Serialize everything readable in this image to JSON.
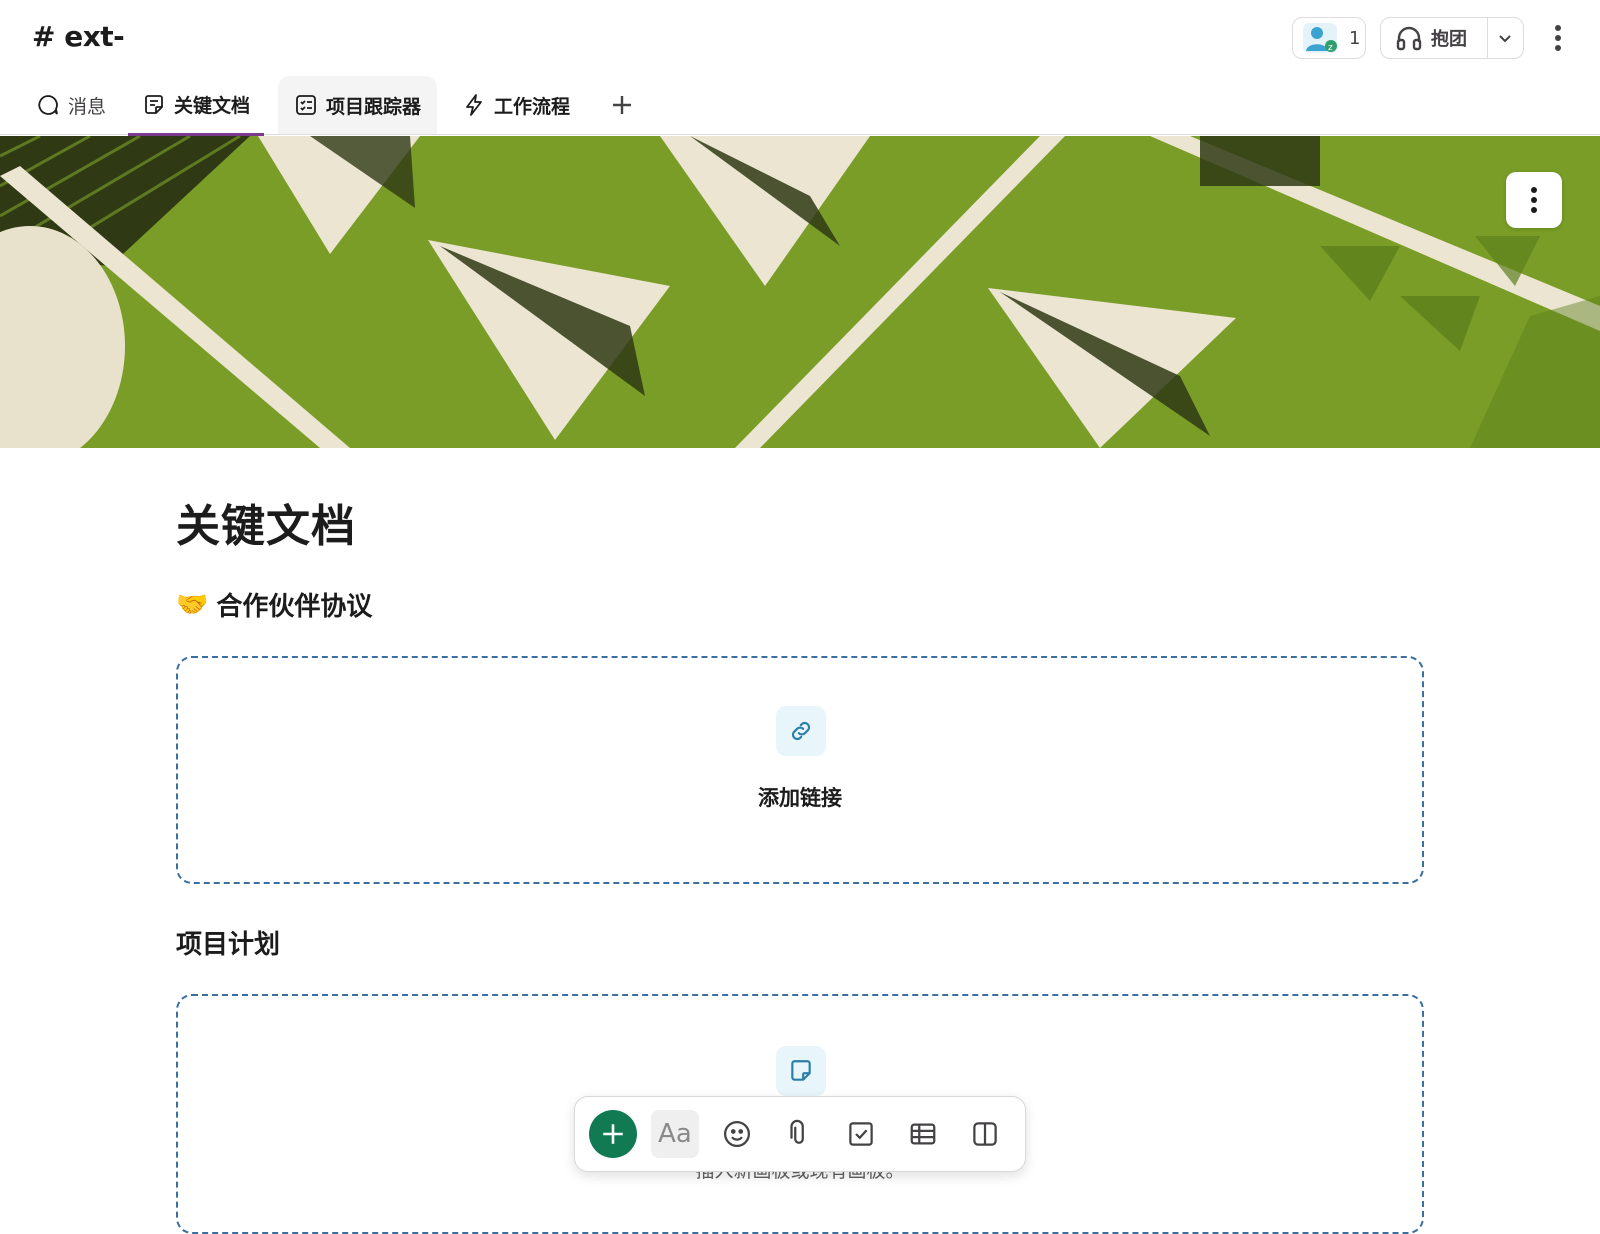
{
  "header": {
    "channel_title": "# ext-",
    "huddle_member_count": "1",
    "huddle_label": "抱团"
  },
  "tabs": [
    {
      "label": "消息",
      "icon": "message-icon"
    },
    {
      "label": "关键文档",
      "icon": "canvas-icon",
      "active": true
    },
    {
      "label": "项目跟踪器",
      "icon": "list-icon"
    },
    {
      "label": "工作流程",
      "icon": "lightning-icon"
    }
  ],
  "document": {
    "title": "关键文档",
    "sections": [
      {
        "emoji": "🤝",
        "heading": "合作伙伴协议",
        "dropzone_label": "添加链接"
      },
      {
        "emoji": "",
        "heading": "项目计划",
        "dropzone_hint": "插入新画板或现有画板。"
      }
    ]
  },
  "toolbar": {
    "text_format_label": "Aa"
  },
  "colors": {
    "accent_purple": "#7a3a8c",
    "add_button_green": "#117a53",
    "dropzone_border": "#3a6fa0",
    "banner_green": "#7fa329"
  }
}
